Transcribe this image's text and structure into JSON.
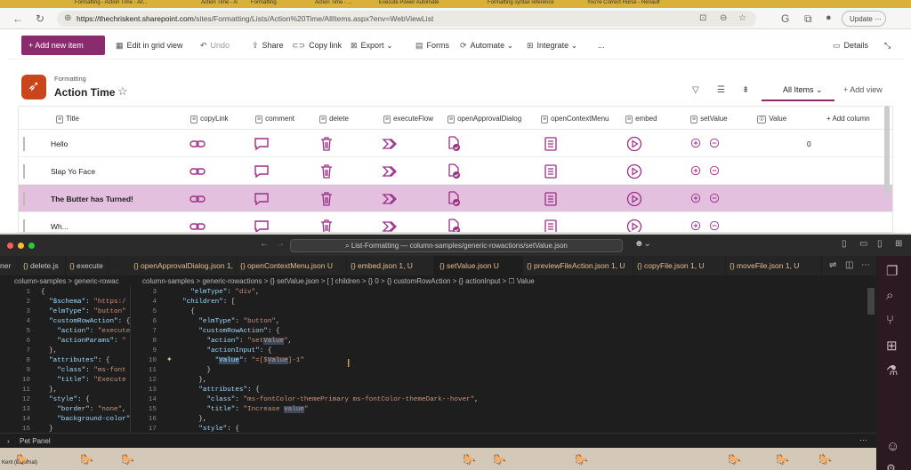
{
  "browser": {
    "tabs": [
      "Formatting - Action Time - All...",
      "Action Time - Al...",
      "Formatting",
      "Action Time - ...",
      "Execute Power Automate",
      "Formatting syntax reference",
      "You're Correct Horse - Renault"
    ],
    "url_host": "https://thechriskent.sharepoint.com",
    "url_path": "/sites/Formatting/Lists/Action%20Time/AllItems.aspx?env=WebViewList",
    "update_label": "Update"
  },
  "commandbar": {
    "new_item": "+  Add new item",
    "items": [
      "Edit in grid view",
      "Undo",
      "Share",
      "Copy link",
      "Export",
      "Forms",
      "Automate",
      "Integrate",
      "..."
    ],
    "details": "Details"
  },
  "list": {
    "site": "Formatting",
    "title": "Action Time",
    "view": "All Items",
    "add_view": "+  Add view",
    "columns": [
      "Title",
      "copyLink",
      "comment",
      "delete",
      "executeFlow",
      "openApprovalDialog",
      "openContextMenu",
      "embed",
      "setValue",
      "Value",
      "+ Add column"
    ],
    "rows": [
      {
        "title": "Hello",
        "value": "0"
      },
      {
        "title": "Slap Yo Face",
        "value": ""
      },
      {
        "title": "The Butter has Turned!",
        "value": ""
      },
      {
        "title": "Wh...",
        "value": ""
      }
    ]
  },
  "editor": {
    "command_center": "List-Formatting — column-samples/generic-rowactions/setValue.json",
    "tabs": [
      "ner",
      "delete.js",
      "execute",
      "openApprovalDialog.json 1, U",
      "openContextMenu.json U",
      "embed.json 1, U",
      "setValue.json U",
      "previewFileAction.json 1, U",
      "copyFile.json 1, U",
      "moveFile.json 1, U"
    ],
    "left_crumb": "column-samples > generic-rowac",
    "right_crumb": "column-samples > generic-rowactions > {} setValue.json > [ ] children > {} 0 > {} customRowAction > {} actionInput > ☐ Value",
    "panel_title": "Pet Panel",
    "pet_label": "Kent (External)"
  }
}
